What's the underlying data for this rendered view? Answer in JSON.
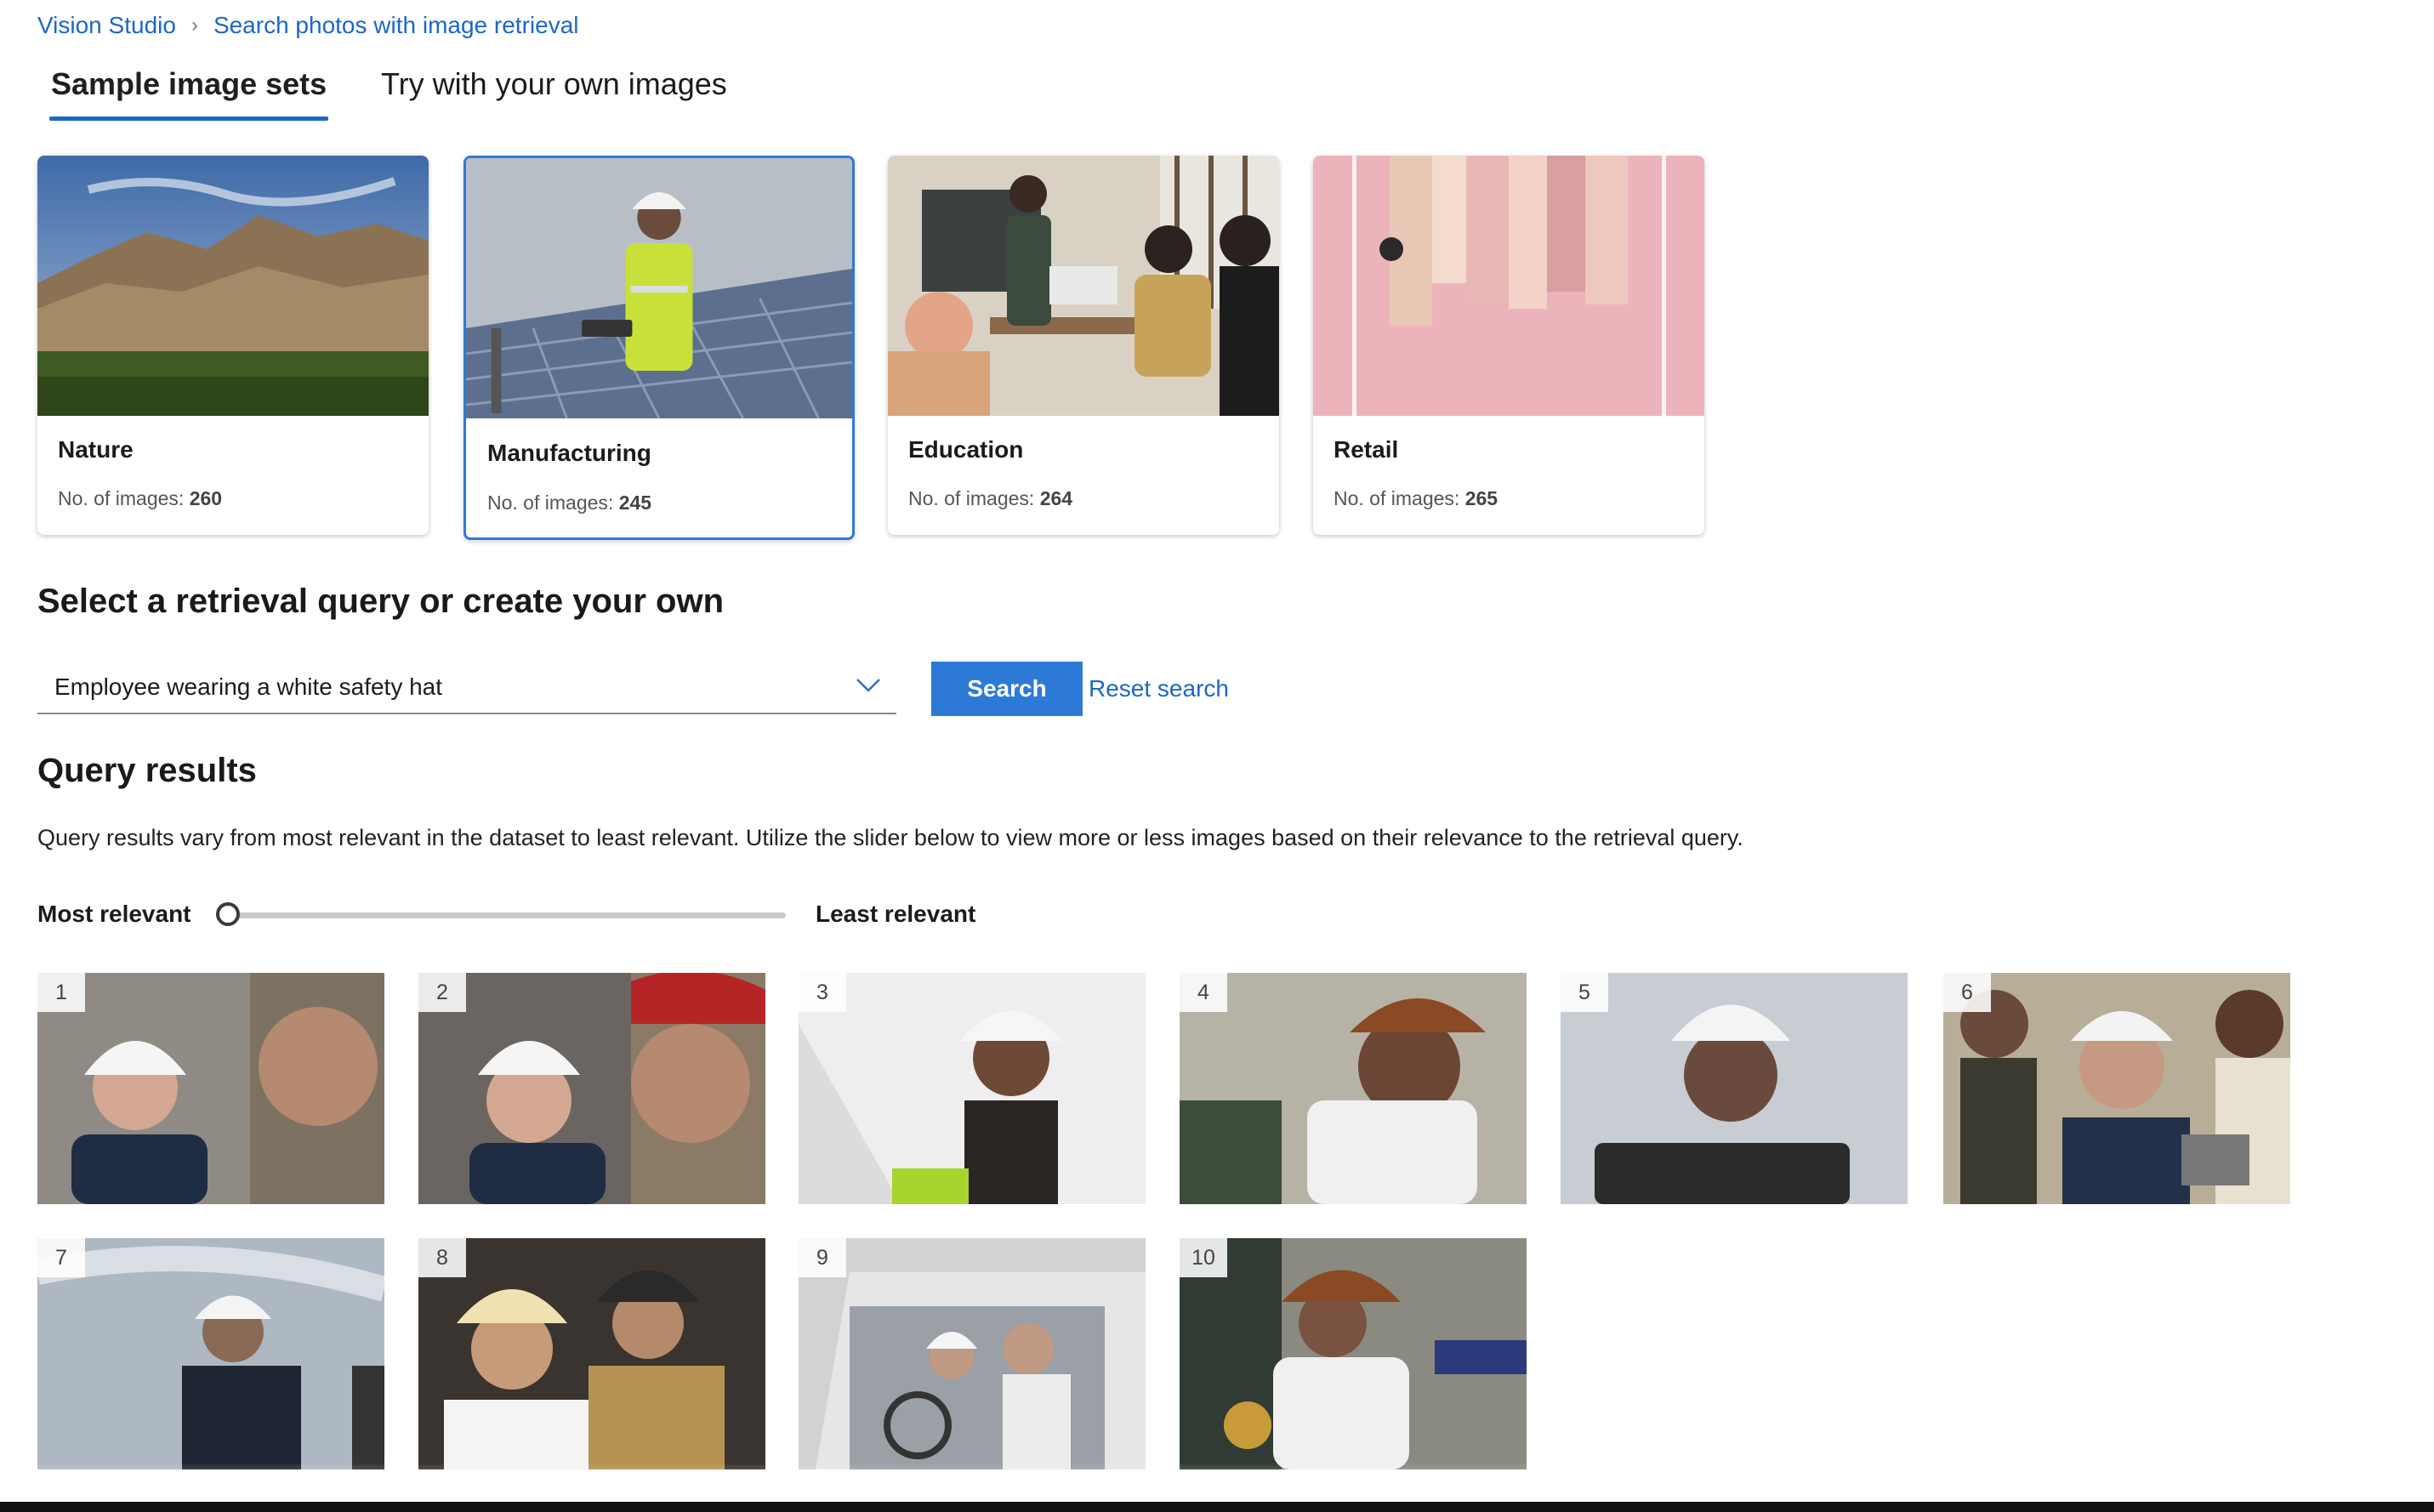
{
  "breadcrumb": {
    "root": "Vision Studio",
    "separator": "›",
    "current": "Search photos with image retrieval"
  },
  "tabs": [
    {
      "label": "Sample image sets",
      "active": true
    },
    {
      "label": "Try with your own images",
      "active": false
    }
  ],
  "sample_sets": [
    {
      "title": "Nature",
      "count_label": "No. of images:",
      "count": "260",
      "selected": false
    },
    {
      "title": "Manufacturing",
      "count_label": "No. of images:",
      "count": "245",
      "selected": true
    },
    {
      "title": "Education",
      "count_label": "No. of images:",
      "count": "264",
      "selected": false
    },
    {
      "title": "Retail",
      "count_label": "No. of images:",
      "count": "265",
      "selected": false
    }
  ],
  "query": {
    "heading": "Select a retrieval query or create your own",
    "selected": "Employee wearing a white safety hat",
    "search_label": "Search",
    "reset_label": "Reset search"
  },
  "results": {
    "heading": "Query results",
    "description": "Query results vary from most relevant in the dataset to least relevant. Utilize the slider below to view more or less images based on their relevance to the retrieval query.",
    "slider": {
      "min_label": "Most relevant",
      "max_label": "Least relevant",
      "value": 0
    },
    "items": [
      "1",
      "2",
      "3",
      "4",
      "5",
      "6",
      "7",
      "8",
      "9",
      "10"
    ]
  },
  "colors": {
    "accent": "#2d7ad6",
    "link": "#1c67c9"
  }
}
